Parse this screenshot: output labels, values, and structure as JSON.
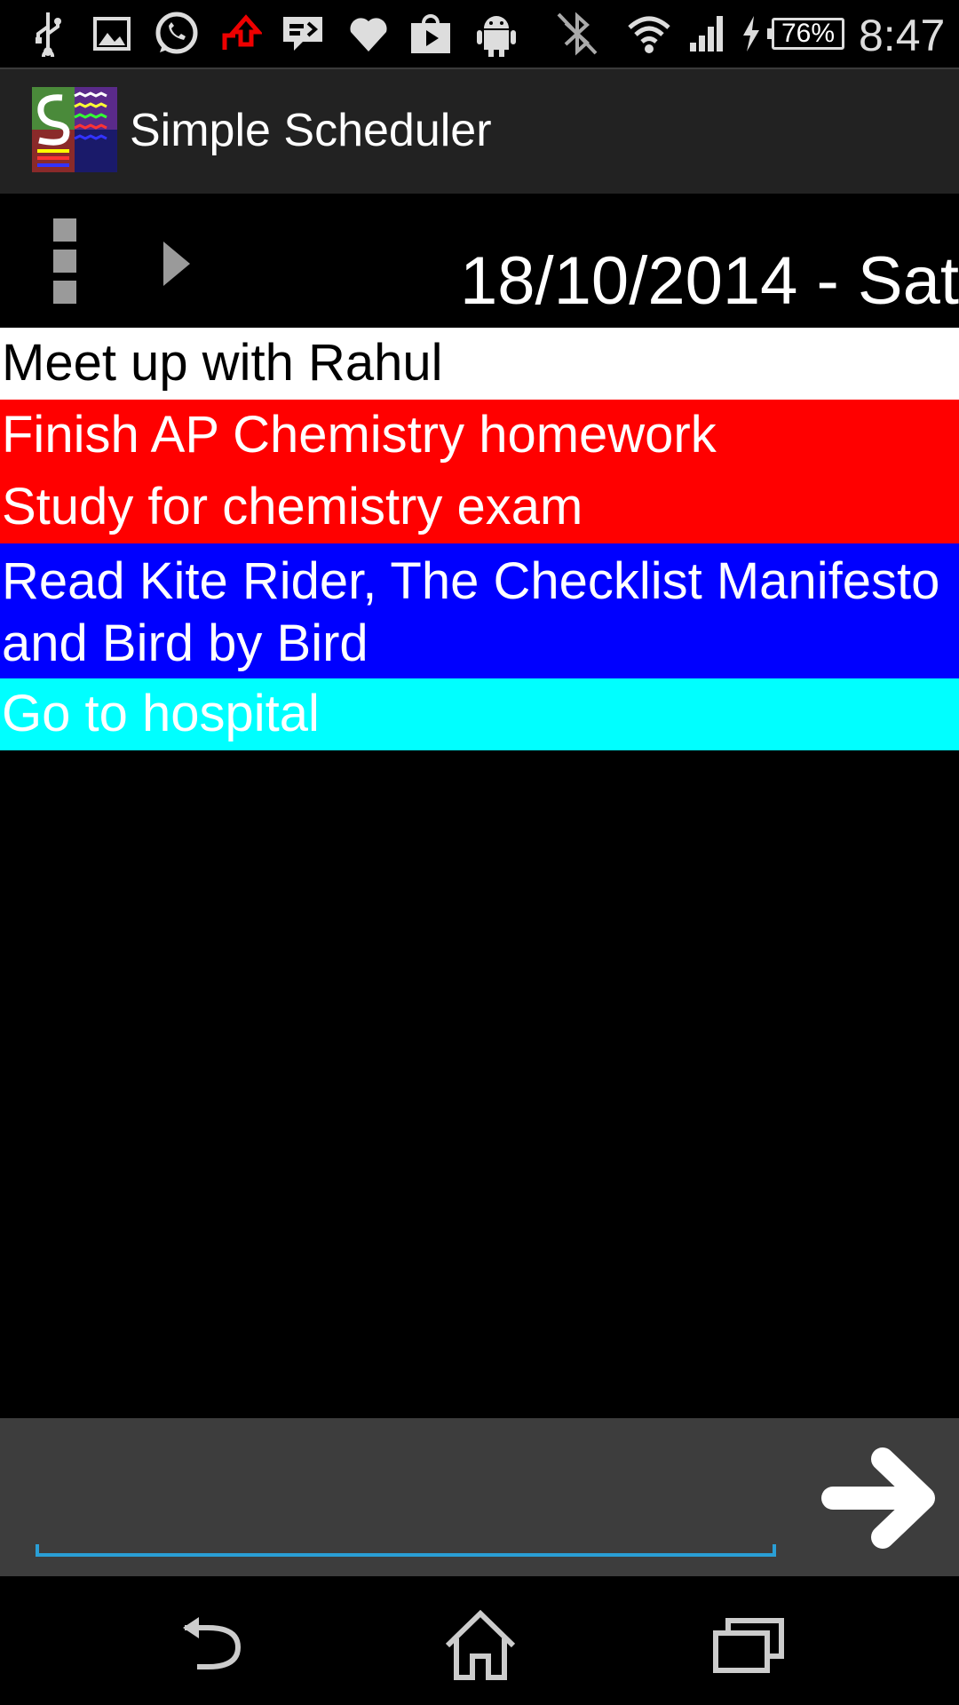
{
  "status_bar": {
    "icons": [
      "usb-icon",
      "gallery-icon",
      "whatsapp-icon",
      "upload-icon",
      "message-icon",
      "heart-icon",
      "play-store-icon",
      "android-icon",
      "bluetooth-off-icon",
      "wifi-icon",
      "signal-icon",
      "charging-icon"
    ],
    "battery": "76%",
    "time": "8:47"
  },
  "app": {
    "title": "Simple Scheduler",
    "logo_icon": "simple-scheduler-logo-icon"
  },
  "date_header": {
    "date": "18/10/2014 - Sat",
    "menu_icon": "overflow-menu-icon",
    "next_icon": "next-day-arrow-icon"
  },
  "tasks": [
    {
      "text": "Meet up with Rahul",
      "bg": "#ffffff",
      "fg": "#000000"
    },
    {
      "text": "Finish AP Chemistry homework",
      "bg": "#ff0000",
      "fg": "#ffffff"
    },
    {
      "text": "Study for chemistry exam",
      "bg": "#ff0000",
      "fg": "#ffffff"
    },
    {
      "text": "Read Kite Rider, The Checklist Manifesto and Bird by Bird",
      "bg": "#0000ff",
      "fg": "#ffffff"
    },
    {
      "text": "Go to hospital",
      "bg": "#00ffff",
      "fg": "#ffffff"
    }
  ],
  "input": {
    "value": "",
    "placeholder": "",
    "submit_icon": "arrow-right-icon"
  },
  "nav_bar": {
    "back_icon": "back-icon",
    "home_icon": "home-icon",
    "recents_icon": "recent-apps-icon"
  },
  "colors": {
    "accent": "#2a9fd6",
    "action_bar": "#222222",
    "input_area": "#3d3d3d"
  }
}
